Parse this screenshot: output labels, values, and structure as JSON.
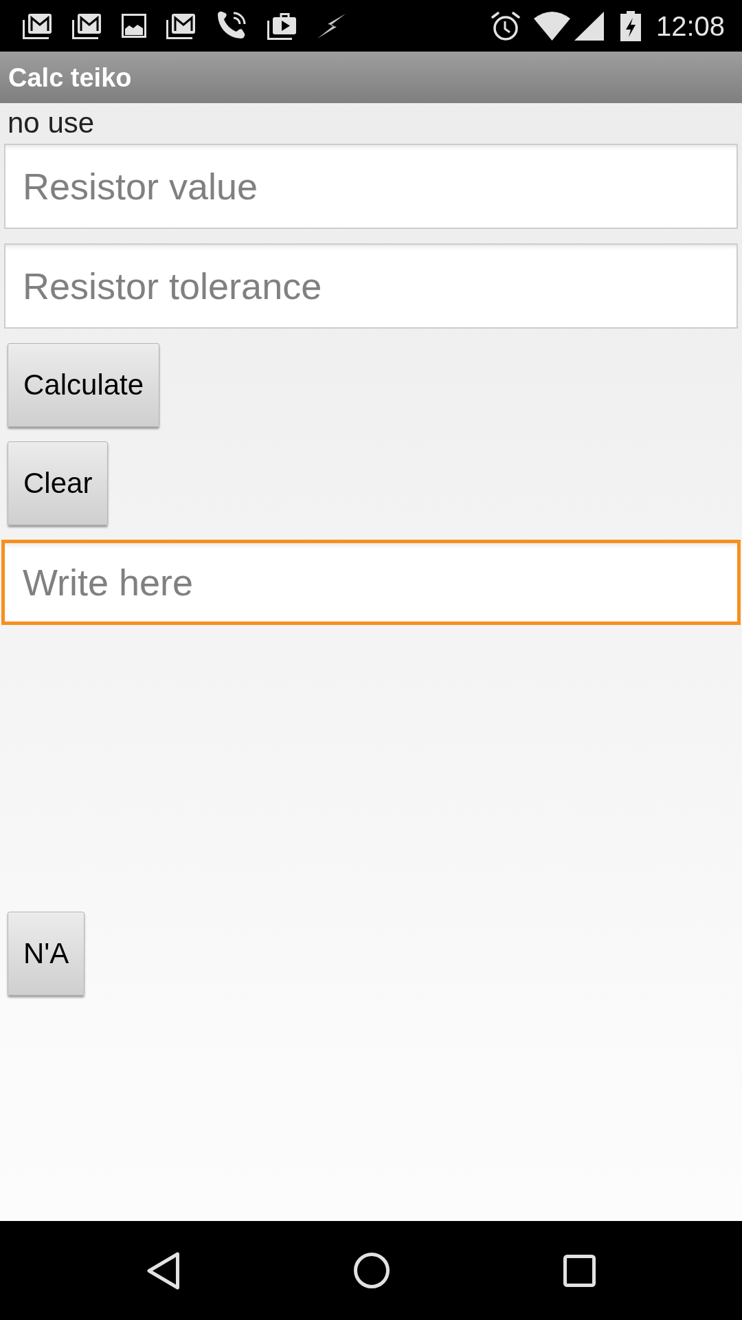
{
  "status_bar": {
    "time": "12:08"
  },
  "app_bar": {
    "title": "Calc teiko"
  },
  "label": "no use",
  "controls": [
    {
      "kind": "field",
      "placeholder": "Resistor value",
      "focused": false
    },
    {
      "kind": "field",
      "placeholder": "Resistor tolerance",
      "focused": false
    },
    {
      "kind": "button",
      "label": "Calculate"
    },
    {
      "kind": "button",
      "label": "Clear"
    },
    {
      "kind": "field",
      "placeholder": "Write here",
      "focused": true
    }
  ],
  "footer_button": {
    "label": "N'A"
  }
}
